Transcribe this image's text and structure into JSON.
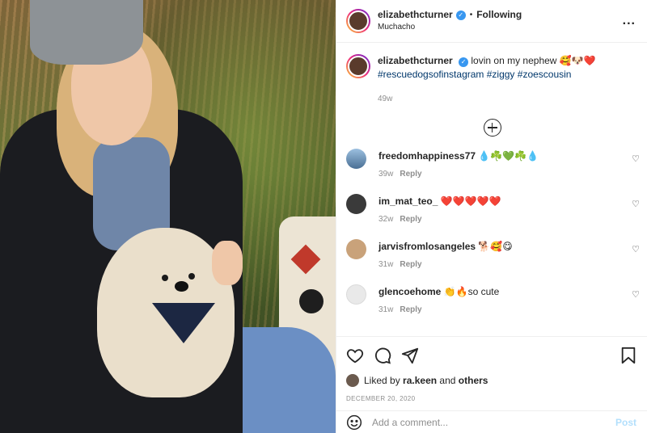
{
  "header": {
    "username": "elizabethcturner",
    "separator": "•",
    "follow_status": "Following",
    "subtitle": "Muchacho",
    "more": "..."
  },
  "caption": {
    "username": "elizabethcturner",
    "text": "lovin on my nephew 🥰🐶❤️",
    "tags": "#rescuedogsofinstagram #ziggy #zoescousin",
    "age": "49w"
  },
  "comments": [
    {
      "user": "freedomhappiness77",
      "text": "💧☘️💚☘️💧",
      "age": "39w",
      "reply": "Reply",
      "avatar_color": "#7fa3c8"
    },
    {
      "user": "im_mat_teo_",
      "text": "❤️❤️❤️❤️❤️",
      "age": "32w",
      "reply": "Reply",
      "avatar_color": "#3a3a3a"
    },
    {
      "user": "jarvisfromlosangeles",
      "text": "🐕🥰😋",
      "age": "31w",
      "reply": "Reply",
      "avatar_color": "#c9a27a"
    },
    {
      "user": "glencoehome",
      "text": "👏🔥so cute",
      "age": "31w",
      "reply": "Reply",
      "avatar_color": "#e9e9e9"
    }
  ],
  "liked_by": {
    "prefix": "Liked by",
    "user": "ra.keen",
    "connector": "and",
    "others": "others"
  },
  "date": "DECEMBER 20, 2020",
  "add_comment": {
    "placeholder": "Add a comment...",
    "post_label": "Post"
  },
  "colors": {
    "link": "#00376b",
    "verified": "#3897f0",
    "post_disabled": "#b2dffc"
  }
}
